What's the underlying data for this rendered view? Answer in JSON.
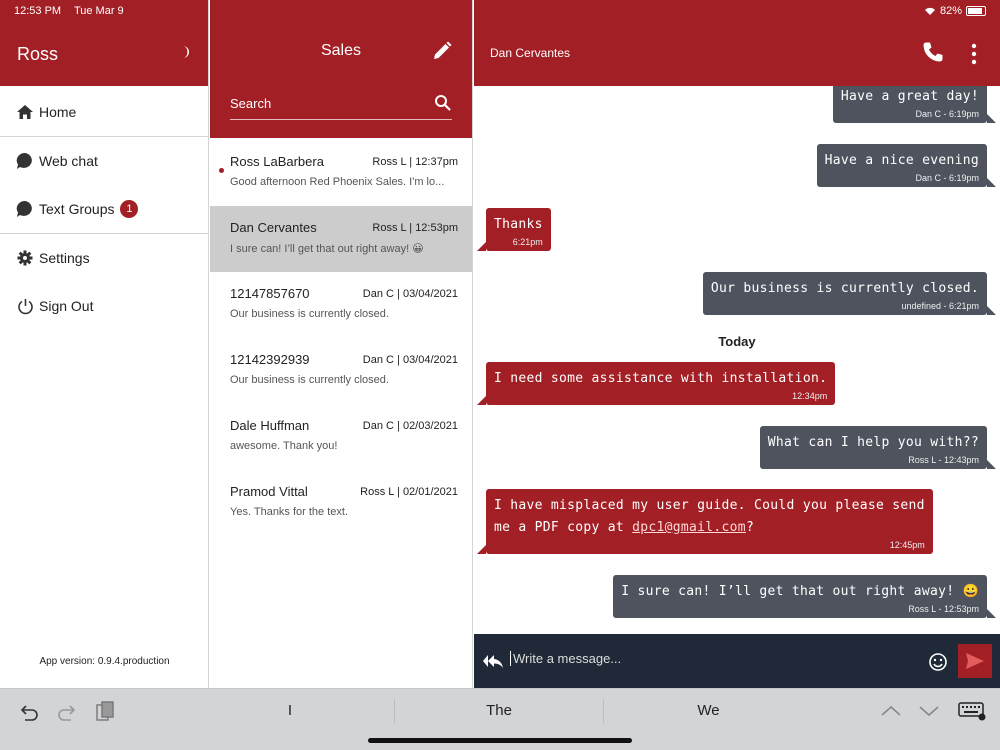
{
  "status": {
    "time": "12:53 PM",
    "date": "Tue Mar 9",
    "battery": "82%"
  },
  "sidebar": {
    "user": "Ross",
    "items": [
      {
        "label": "Home",
        "icon": "home-icon"
      },
      {
        "label": "Web chat",
        "icon": "chat-bubble-icon"
      },
      {
        "label": "Text Groups",
        "icon": "chat-bubble-icon",
        "badge": "1"
      },
      {
        "label": "Settings",
        "icon": "gear-icon"
      },
      {
        "label": "Sign Out",
        "icon": "power-icon"
      }
    ],
    "version": "App version: 0.9.4.production"
  },
  "conversations": {
    "title": "Sales",
    "search_placeholder": "Search",
    "items": [
      {
        "name": "Ross LaBarbera",
        "meta": "Ross L | 12:37pm",
        "preview": "Good afternoon Red Phoenix Sales. I'm lo..."
      },
      {
        "name": "Dan Cervantes",
        "meta": "Ross L | 12:53pm",
        "preview": "I sure can! I’ll get that out right away! 😀"
      },
      {
        "name": "12147857670",
        "meta": "Dan C | 03/04/2021",
        "preview": "Our business is currently closed."
      },
      {
        "name": "12142392939",
        "meta": "Dan C | 03/04/2021",
        "preview": "Our business is currently closed."
      },
      {
        "name": "Dale Huffman",
        "meta": "Dan C | 02/03/2021",
        "preview": "awesome. Thank you!"
      },
      {
        "name": "Pramod Vittal",
        "meta": "Ross L | 02/01/2021",
        "preview": "Yes. Thanks for the text."
      }
    ]
  },
  "chat": {
    "contact": "Dan Cervantes",
    "day_header": "Today",
    "messages": [
      {
        "text": "Have a great day!",
        "time": "Dan C - 6:19pm"
      },
      {
        "text": "Have a nice evening",
        "time": "Dan C - 6:19pm"
      },
      {
        "text": "Thanks",
        "time": "6:21pm"
      },
      {
        "text": "Our business is currently closed.",
        "time": "undefined - 6:21pm"
      },
      {
        "text": "I need some assistance with installation.",
        "time": "12:34pm"
      },
      {
        "text": "What can I help you with??",
        "time": "Ross L - 12:43pm"
      },
      {
        "text_line1": "I have misplaced my user guide. Could you please send",
        "text_line2_pre": "me a PDF copy at ",
        "link": "dpc1@gmail.com",
        "text_line2_post": "?",
        "time": "12:45pm"
      },
      {
        "text": "I sure can! I’ll get that out right away! 😀",
        "time": "Ross L - 12:53pm"
      }
    ],
    "composer_placeholder": "Write a message..."
  },
  "keyboard": {
    "suggestions": [
      "I",
      "The",
      "We"
    ]
  },
  "colors": {
    "brand_red": "#a21f25",
    "bubble_gray": "#4e535e",
    "composer_bg": "#1f2937"
  }
}
